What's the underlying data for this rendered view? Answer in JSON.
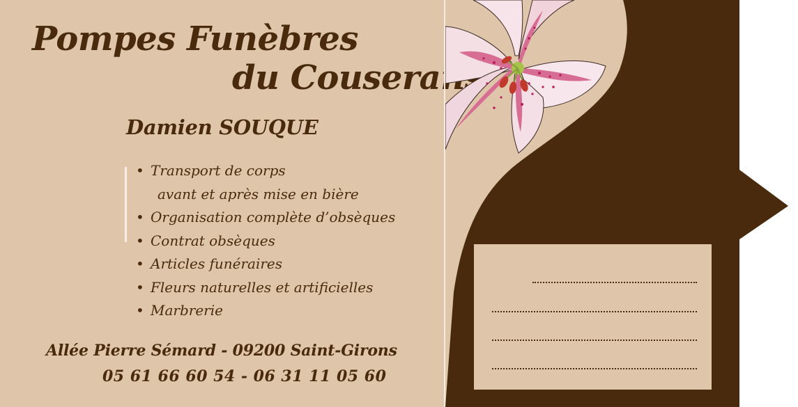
{
  "company": {
    "name_line1": "Pompes Funèbres",
    "name_line2": "du Couserans"
  },
  "owner": {
    "name": "Damien SOUQUE"
  },
  "services": [
    "Transport de corps",
    "avant et après mise en bière",
    "Organisation complète d’obsèques",
    "Contrat obsèques",
    "Articles funéraires",
    "Fleurs naturelles et artificielles",
    "Marbrerie"
  ],
  "contact": {
    "address": "Allée Pierre Sémard - 09200 Saint-Girons",
    "phones": "05 61 66 60 54 - 06 31 11 05 60"
  },
  "colors": {
    "background": "#dfc6aa",
    "brown": "#4a2a0c",
    "white": "#ffffff"
  },
  "icons": {
    "flower": "lily-flower-icon",
    "bullet": "•"
  }
}
